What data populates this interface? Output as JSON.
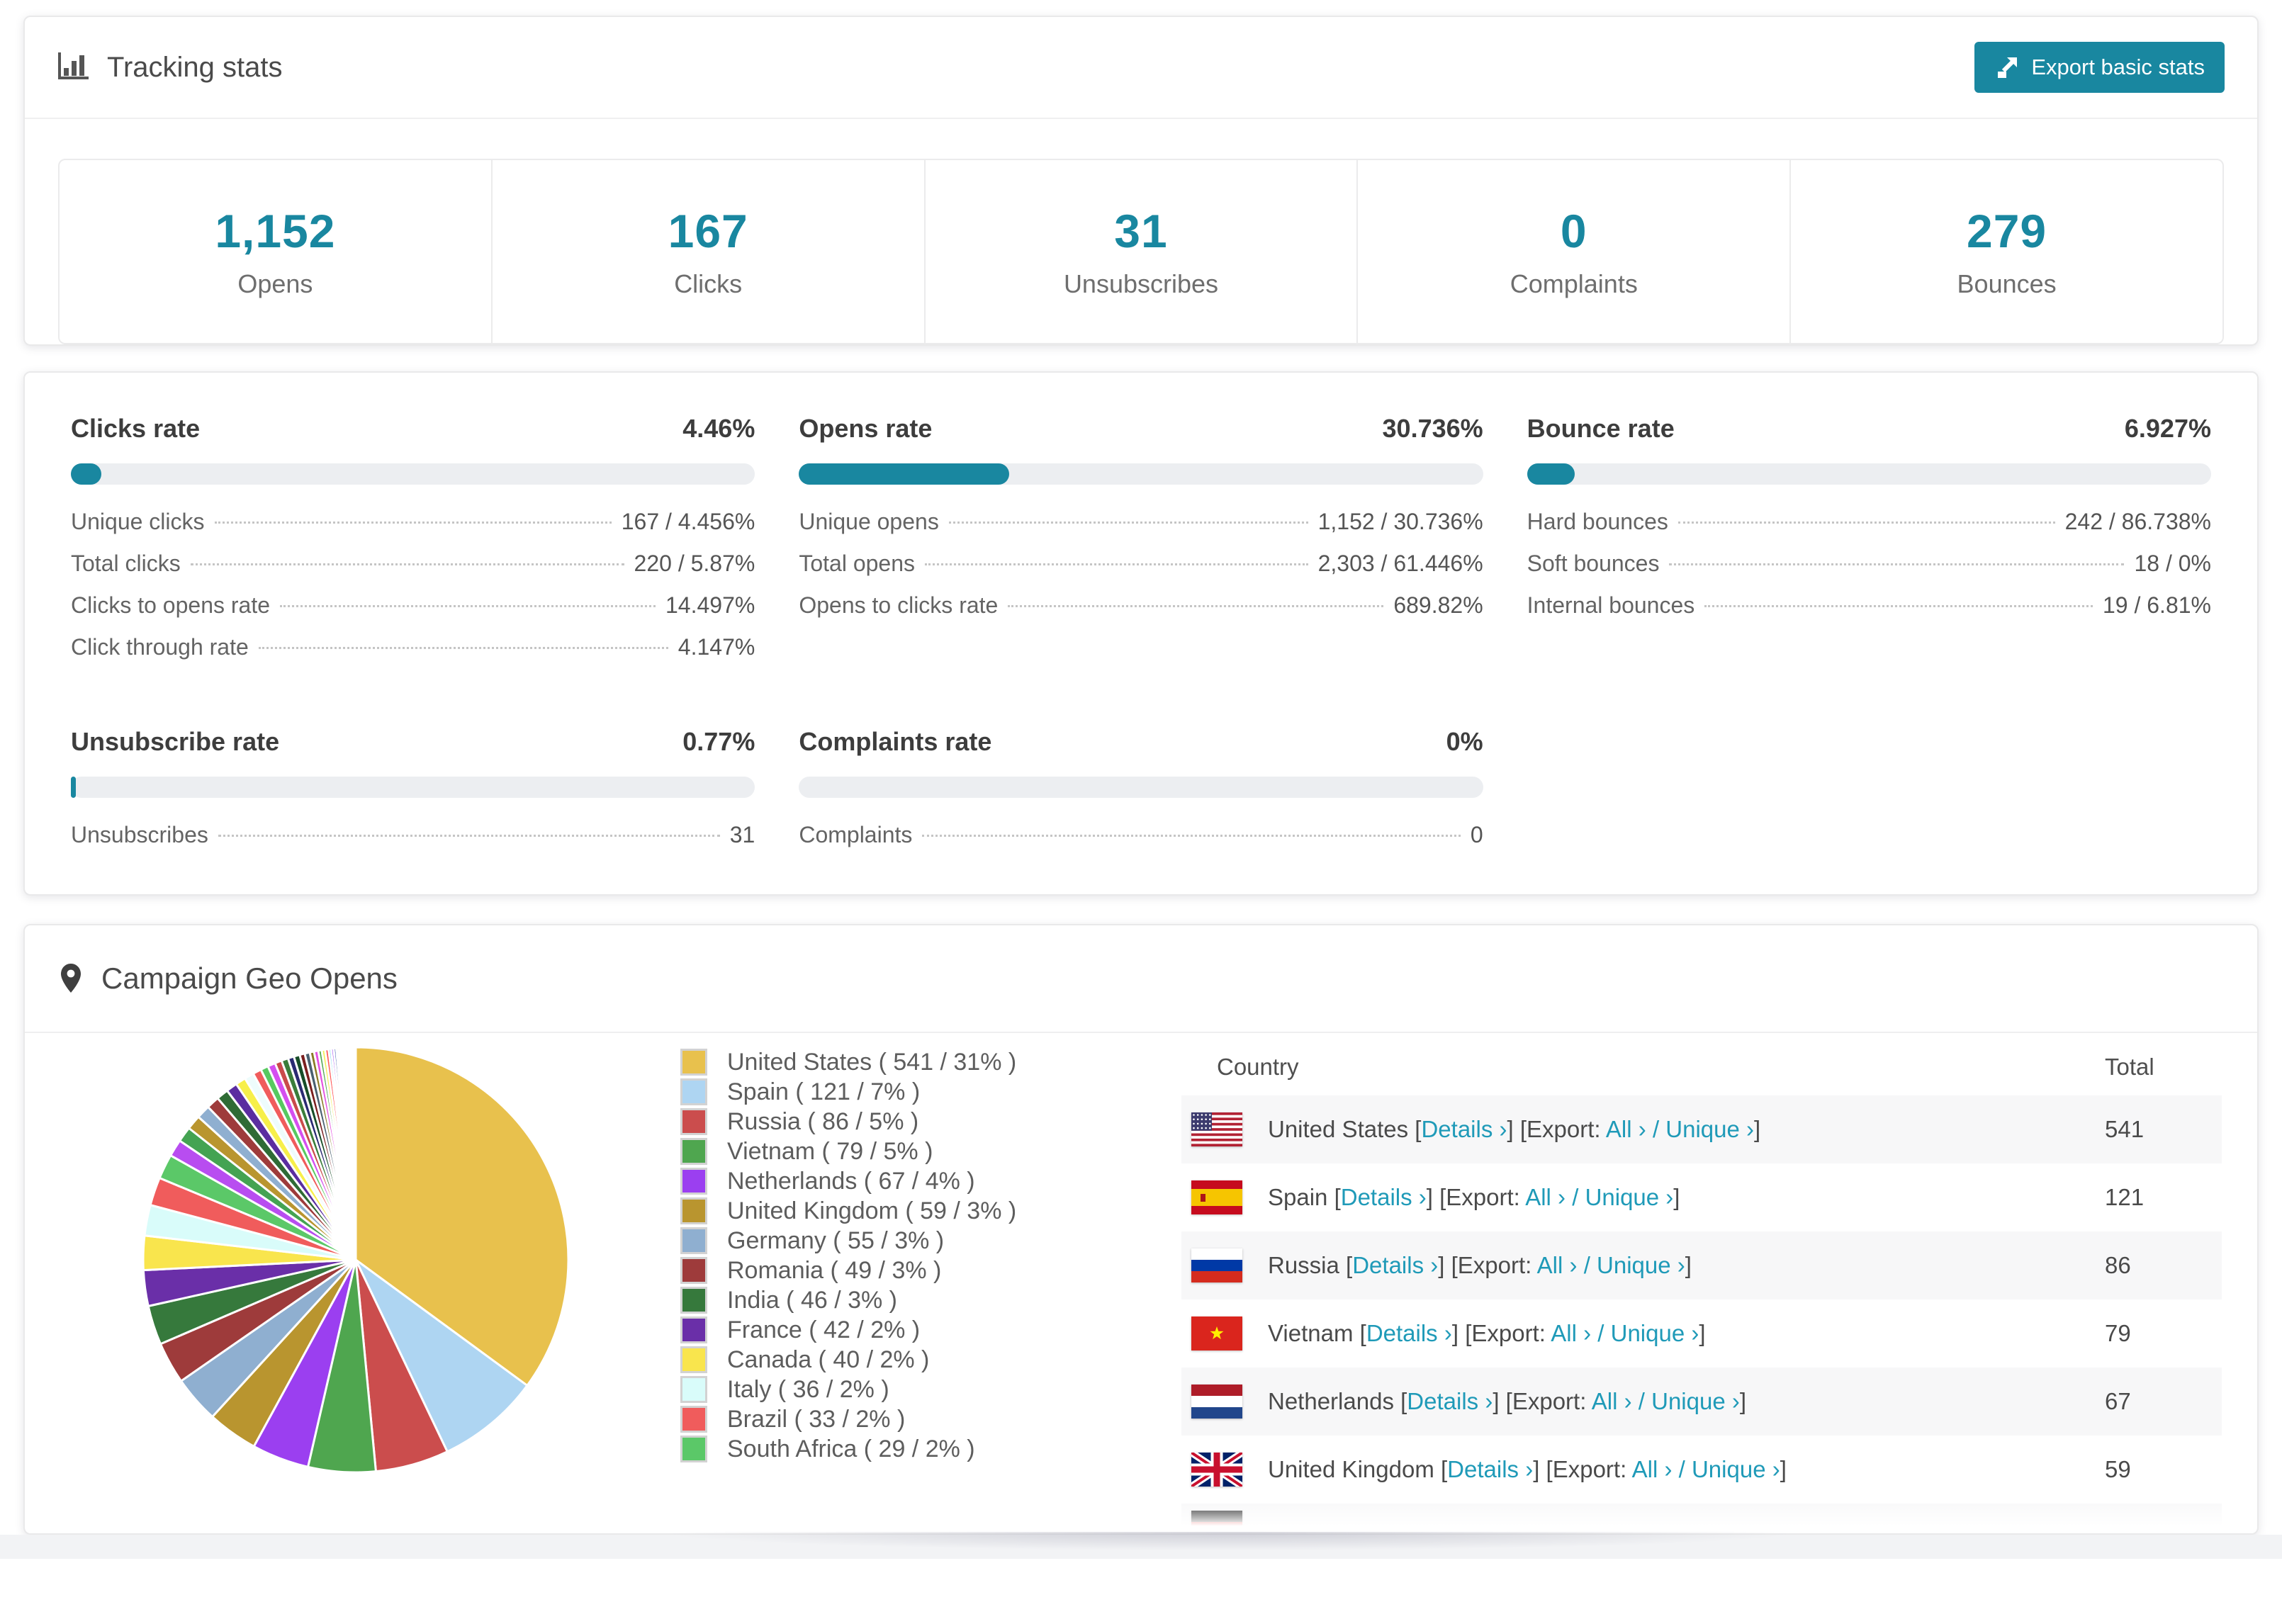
{
  "accent": "#1987a0",
  "tracking": {
    "title": "Tracking stats",
    "export_button": "Export basic stats",
    "stats": [
      {
        "value": "1,152",
        "label": "Opens"
      },
      {
        "value": "167",
        "label": "Clicks"
      },
      {
        "value": "31",
        "label": "Unsubscribes"
      },
      {
        "value": "0",
        "label": "Complaints"
      },
      {
        "value": "279",
        "label": "Bounces"
      }
    ]
  },
  "rates": {
    "blocks": [
      {
        "title": "Clicks rate",
        "value": "4.46%",
        "percent": 4.46,
        "rows": [
          {
            "label": "Unique clicks",
            "value": "167 / 4.456%"
          },
          {
            "label": "Total clicks",
            "value": "220 / 5.87%"
          },
          {
            "label": "Clicks to opens rate",
            "value": "14.497%"
          },
          {
            "label": "Click through rate",
            "value": "4.147%"
          }
        ]
      },
      {
        "title": "Opens rate",
        "value": "30.736%",
        "percent": 30.736,
        "rows": [
          {
            "label": "Unique opens",
            "value": "1,152 / 30.736%"
          },
          {
            "label": "Total opens",
            "value": "2,303 / 61.446%"
          },
          {
            "label": "Opens to clicks rate",
            "value": "689.82%"
          }
        ]
      },
      {
        "title": "Bounce rate",
        "value": "6.927%",
        "percent": 6.927,
        "rows": [
          {
            "label": "Hard bounces",
            "value": "242 / 86.738%"
          },
          {
            "label": "Soft bounces",
            "value": "18 / 0%"
          },
          {
            "label": "Internal bounces",
            "value": "19 / 6.81%"
          }
        ]
      },
      {
        "title": "Unsubscribe rate",
        "value": "0.77%",
        "percent": 0.77,
        "rows": [
          {
            "label": "Unsubscribes",
            "value": "31"
          }
        ]
      },
      {
        "title": "Complaints rate",
        "value": "0%",
        "percent": 0,
        "rows": [
          {
            "label": "Complaints",
            "value": "0"
          }
        ]
      }
    ]
  },
  "geo": {
    "title": "Campaign Geo Opens",
    "table": {
      "headers": [
        "Country",
        "Total"
      ],
      "labels": {
        "lbracket": "[",
        "rbracket": "]",
        "details": "Details ›",
        "export_prefix": "[Export:",
        "all": "All ›",
        "slash": "/",
        "unique": "Unique ›"
      },
      "rows": [
        {
          "country": "United States",
          "flag": "us",
          "total": "541"
        },
        {
          "country": "Spain",
          "flag": "es",
          "total": "121"
        },
        {
          "country": "Russia",
          "flag": "ru",
          "total": "86"
        },
        {
          "country": "Vietnam",
          "flag": "vn",
          "total": "79"
        },
        {
          "country": "Netherlands",
          "flag": "nl",
          "total": "67"
        },
        {
          "country": "United Kingdom",
          "flag": "gb",
          "total": "59"
        },
        {
          "country": "",
          "flag": "de",
          "total": "",
          "partial": true
        }
      ]
    }
  },
  "chart_data": {
    "type": "pie",
    "title": "Campaign Geo Opens",
    "legend_position": "right",
    "start_angle_deg": -90,
    "direction": "clockwise",
    "series": [
      {
        "name": "United States",
        "value": 541,
        "percent": 31,
        "color": "#e8c14d",
        "legend_label": "United States ( 541 / 31% )"
      },
      {
        "name": "Spain",
        "value": 121,
        "percent": 7,
        "color": "#aed5f2",
        "legend_label": "Spain ( 121 / 7% )"
      },
      {
        "name": "Russia",
        "value": 86,
        "percent": 5,
        "color": "#cb4d4d",
        "legend_label": "Russia ( 86 / 5% )"
      },
      {
        "name": "Vietnam",
        "value": 79,
        "percent": 5,
        "color": "#4fa64f",
        "legend_label": "Vietnam ( 79 / 5% )"
      },
      {
        "name": "Netherlands",
        "value": 67,
        "percent": 4,
        "color": "#9b3ff0",
        "legend_label": "Netherlands ( 67 / 4% )"
      },
      {
        "name": "United Kingdom",
        "value": 59,
        "percent": 3,
        "color": "#b9952f",
        "legend_label": "United Kingdom ( 59 / 3% )"
      },
      {
        "name": "Germany",
        "value": 55,
        "percent": 3,
        "color": "#8fafd0",
        "legend_label": "Germany ( 55 / 3% )"
      },
      {
        "name": "Romania",
        "value": 49,
        "percent": 3,
        "color": "#9e3b3b",
        "legend_label": "Romania ( 49 / 3% )"
      },
      {
        "name": "India",
        "value": 46,
        "percent": 3,
        "color": "#36793c",
        "legend_label": "India ( 46 / 3% )"
      },
      {
        "name": "France",
        "value": 42,
        "percent": 2,
        "color": "#6a2fa8",
        "legend_label": "France ( 42 / 2% )"
      },
      {
        "name": "Canada",
        "value": 40,
        "percent": 2,
        "color": "#f9e54d",
        "legend_label": "Canada ( 40 / 2% )"
      },
      {
        "name": "Italy",
        "value": 36,
        "percent": 2,
        "color": "#d9fcfa",
        "legend_label": "Italy ( 36 / 2% )"
      },
      {
        "name": "Brazil",
        "value": 33,
        "percent": 2,
        "color": "#f05c5c",
        "legend_label": "Brazil ( 33 / 2% )"
      },
      {
        "name": "South Africa",
        "value": 29,
        "percent": 2,
        "color": "#5bc868",
        "legend_label": "South Africa ( 29 / 2% )"
      }
    ],
    "unlabeled_small_slices": {
      "values": [
        20,
        18,
        17,
        16,
        15,
        14,
        13,
        12,
        11,
        10,
        9,
        9,
        8,
        8,
        7,
        7,
        6,
        6,
        5,
        5,
        4,
        4,
        4,
        3,
        3,
        3,
        2.5,
        2.5,
        2,
        2,
        2,
        1.5,
        1.5,
        1.2,
        1,
        1,
        0.9,
        0.8,
        0.7,
        0.6,
        0.5,
        0.5,
        0.4,
        0.4,
        0.3,
        0.3
      ],
      "colors": [
        "#b84df0",
        "#44a352",
        "#b9952f",
        "#8fafd0",
        "#9e3b3b",
        "#2f6b35",
        "#5b2da0",
        "#f7ef4a",
        "#eefcfc",
        "#f05c5c",
        "#57c960",
        "#d44ff0",
        "#c94b4b",
        "#3a7d3a",
        "#2a2a72",
        "#174d28",
        "#7a1f1f",
        "#4a6070",
        "#8a7a25",
        "#e44fe0",
        "#4fa64f",
        "#f4ef55",
        "#ff5555",
        "#66ccee",
        "#9b3ff0",
        "#3355aa",
        "#ccb830",
        "#f08080",
        "#50b050",
        "#8833cc",
        "#d0d0f8",
        "#f0c040",
        "#70c8e8",
        "#e070c0",
        "#408040",
        "#a05050",
        "#5050a0",
        "#c0c040",
        "#40c0c0",
        "#c04040",
        "#80e080",
        "#e080e0",
        "#808040",
        "#4080c0",
        "#c08040",
        "#44b088"
      ]
    }
  }
}
